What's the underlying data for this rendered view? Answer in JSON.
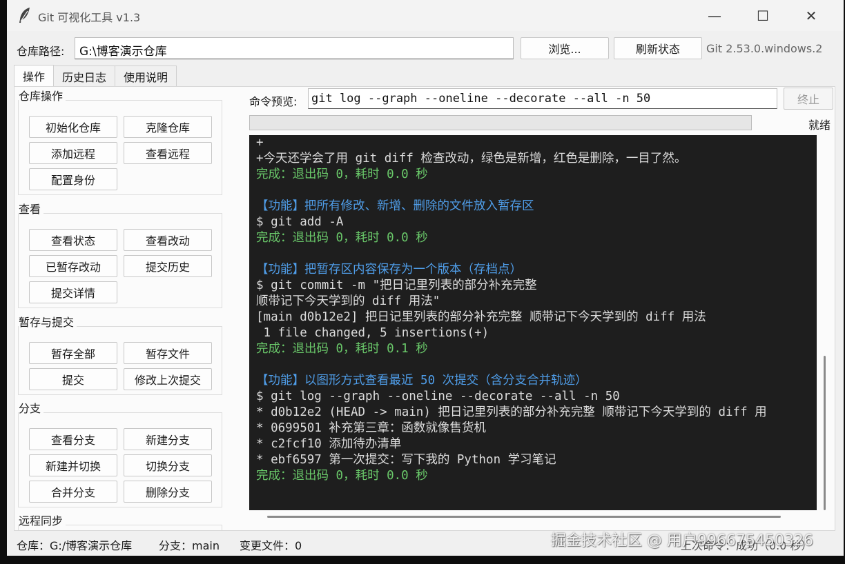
{
  "window": {
    "title": "Git 可视化工具 v1.3",
    "controls": {
      "minimize": "—",
      "maximize": "☐",
      "close": "✕"
    }
  },
  "repo": {
    "label": "仓库路径:",
    "path_value": "G:\\博客演示仓库",
    "browse_label": "浏览...",
    "refresh_label": "刷新状态",
    "git_version": "Git 2.53.0.windows.2"
  },
  "tabs": [
    {
      "label": "操作",
      "active": true
    },
    {
      "label": "历史日志",
      "active": false
    },
    {
      "label": "使用说明",
      "active": false
    }
  ],
  "groups": {
    "repo_ops": {
      "title": "仓库操作",
      "buttons": [
        "初始化仓库",
        "克隆仓库",
        "添加远程",
        "查看远程",
        "配置身份"
      ]
    },
    "view": {
      "title": "查看",
      "buttons": [
        "查看状态",
        "查看改动",
        "已暂存改动",
        "提交历史",
        "提交详情"
      ]
    },
    "stage_commit": {
      "title": "暂存与提交",
      "buttons": [
        "暂存全部",
        "暂存文件",
        "提交",
        "修改上次提交"
      ]
    },
    "branch": {
      "title": "分支",
      "buttons": [
        "查看分支",
        "新建分支",
        "新建并切换",
        "切换分支",
        "合并分支",
        "删除分支"
      ]
    },
    "remote": {
      "title": "远程同步"
    }
  },
  "command": {
    "label": "命令预览:",
    "value": "git log --graph --oneline --decorate --all -n 50",
    "stop_label": "终止",
    "status": "就绪",
    "progress": 0
  },
  "console": {
    "lines": [
      {
        "text": "+",
        "kind": "normal"
      },
      {
        "text": "+今天还学会了用 git diff 检查改动，绿色是新增，红色是删除，一目了然。",
        "kind": "normal"
      },
      {
        "text": "完成：退出码 0，耗时 0.0 秒",
        "kind": "ok"
      },
      {
        "text": "",
        "kind": "normal"
      },
      {
        "text": "【功能】把所有修改、新增、删除的文件放入暂存区",
        "kind": "fn"
      },
      {
        "text": "$ git add -A",
        "kind": "normal"
      },
      {
        "text": "完成：退出码 0，耗时 0.0 秒",
        "kind": "ok"
      },
      {
        "text": "",
        "kind": "normal"
      },
      {
        "text": "【功能】把暂存区内容保存为一个版本（存档点）",
        "kind": "fn"
      },
      {
        "text": "$ git commit -m \"把日记里列表的部分补充完整",
        "kind": "normal"
      },
      {
        "text": "顺带记下今天学到的 diff 用法\"",
        "kind": "normal"
      },
      {
        "text": "[main d0b12e2] 把日记里列表的部分补充完整 顺带记下今天学到的 diff 用法",
        "kind": "normal"
      },
      {
        "text": " 1 file changed, 5 insertions(+)",
        "kind": "normal"
      },
      {
        "text": "完成：退出码 0，耗时 0.1 秒",
        "kind": "ok"
      },
      {
        "text": "",
        "kind": "normal"
      },
      {
        "text": "【功能】以图形方式查看最近 50 次提交（含分支合并轨迹）",
        "kind": "fn"
      },
      {
        "text": "$ git log --graph --oneline --decorate --all -n 50",
        "kind": "normal"
      },
      {
        "text": "* d0b12e2 (HEAD -> main) 把日记里列表的部分补充完整 顺带记下今天学到的 diff 用",
        "kind": "normal"
      },
      {
        "text": "* 0699501 补充第三章：函数就像售货机",
        "kind": "normal"
      },
      {
        "text": "* c2fcf10 添加待办清单",
        "kind": "normal"
      },
      {
        "text": "* ebf6597 第一次提交：写下我的 Python 学习笔记",
        "kind": "normal"
      },
      {
        "text": "完成：退出码 0，耗时 0.0 秒",
        "kind": "ok"
      }
    ]
  },
  "statusbar": {
    "repo": "仓库：G:/博客演示仓库",
    "branch": "分支：main",
    "changes": "变更文件：0",
    "last_cmd": "上次命令：成功（0.0 秒）"
  },
  "watermark": "掘金技术社区 @ 用户996675450326"
}
